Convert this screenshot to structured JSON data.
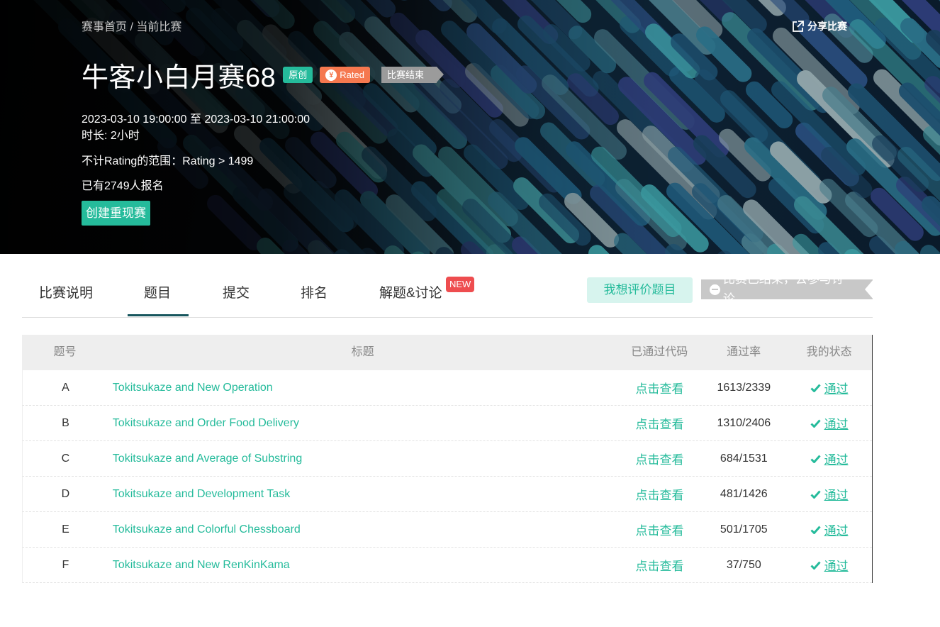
{
  "breadcrumb": {
    "home": "赛事首页",
    "sep": " / ",
    "current": "当前比赛"
  },
  "share_label": "分享比赛",
  "contest": {
    "title": "牛客小白月赛68",
    "tag_original": "原创",
    "tag_rated": "Rated",
    "tag_rated_symbol": "¥",
    "tag_ended": "比赛结束",
    "time_range": "2023-03-10 19:00:00 至 2023-03-10 21:00:00",
    "duration": "时长: 2小时",
    "rating_range": "不计Rating的范围：Rating > 1499",
    "registered": "已有2749人报名",
    "rerun_button": "创建重现赛"
  },
  "tabs": [
    {
      "label": "比赛说明"
    },
    {
      "label": "题目",
      "active": true
    },
    {
      "label": "提交"
    },
    {
      "label": "排名"
    },
    {
      "label": "解题&讨论",
      "badge": "NEW"
    }
  ],
  "actions": {
    "evaluate": "我想评价题目",
    "discuss": "比赛已结束，去参与讨论"
  },
  "table": {
    "headers": {
      "id": "题号",
      "title": "标题",
      "code": "已通过代码",
      "rate": "通过率",
      "status": "我的状态"
    },
    "rows": [
      {
        "id": "A",
        "title": "Tokitsukaze and New Operation",
        "code": "点击查看",
        "rate": "1613/2339",
        "status": "通过"
      },
      {
        "id": "B",
        "title": "Tokitsukaze and Order Food Delivery",
        "code": "点击查看",
        "rate": "1310/2406",
        "status": "通过"
      },
      {
        "id": "C",
        "title": "Tokitsukaze and Average of Substring",
        "code": "点击查看",
        "rate": "684/1531",
        "status": "通过"
      },
      {
        "id": "D",
        "title": "Tokitsukaze and Development Task",
        "code": "点击查看",
        "rate": "481/1426",
        "status": "通过"
      },
      {
        "id": "E",
        "title": "Tokitsukaze and Colorful Chessboard",
        "code": "点击查看",
        "rate": "501/1705",
        "status": "通过"
      },
      {
        "id": "F",
        "title": "Tokitsukaze and New RenKinKama",
        "code": "点击查看",
        "rate": "37/750",
        "status": "通过"
      }
    ]
  },
  "colors": {
    "accent": "#25bb9b",
    "rated": "#f5784f",
    "new_badge": "#ee4d4f",
    "tab_underline": "#17565d"
  },
  "icons": {
    "share": "share-icon",
    "check": "check-icon",
    "yen": "yen-icon",
    "minus": "minus-circle-icon"
  }
}
